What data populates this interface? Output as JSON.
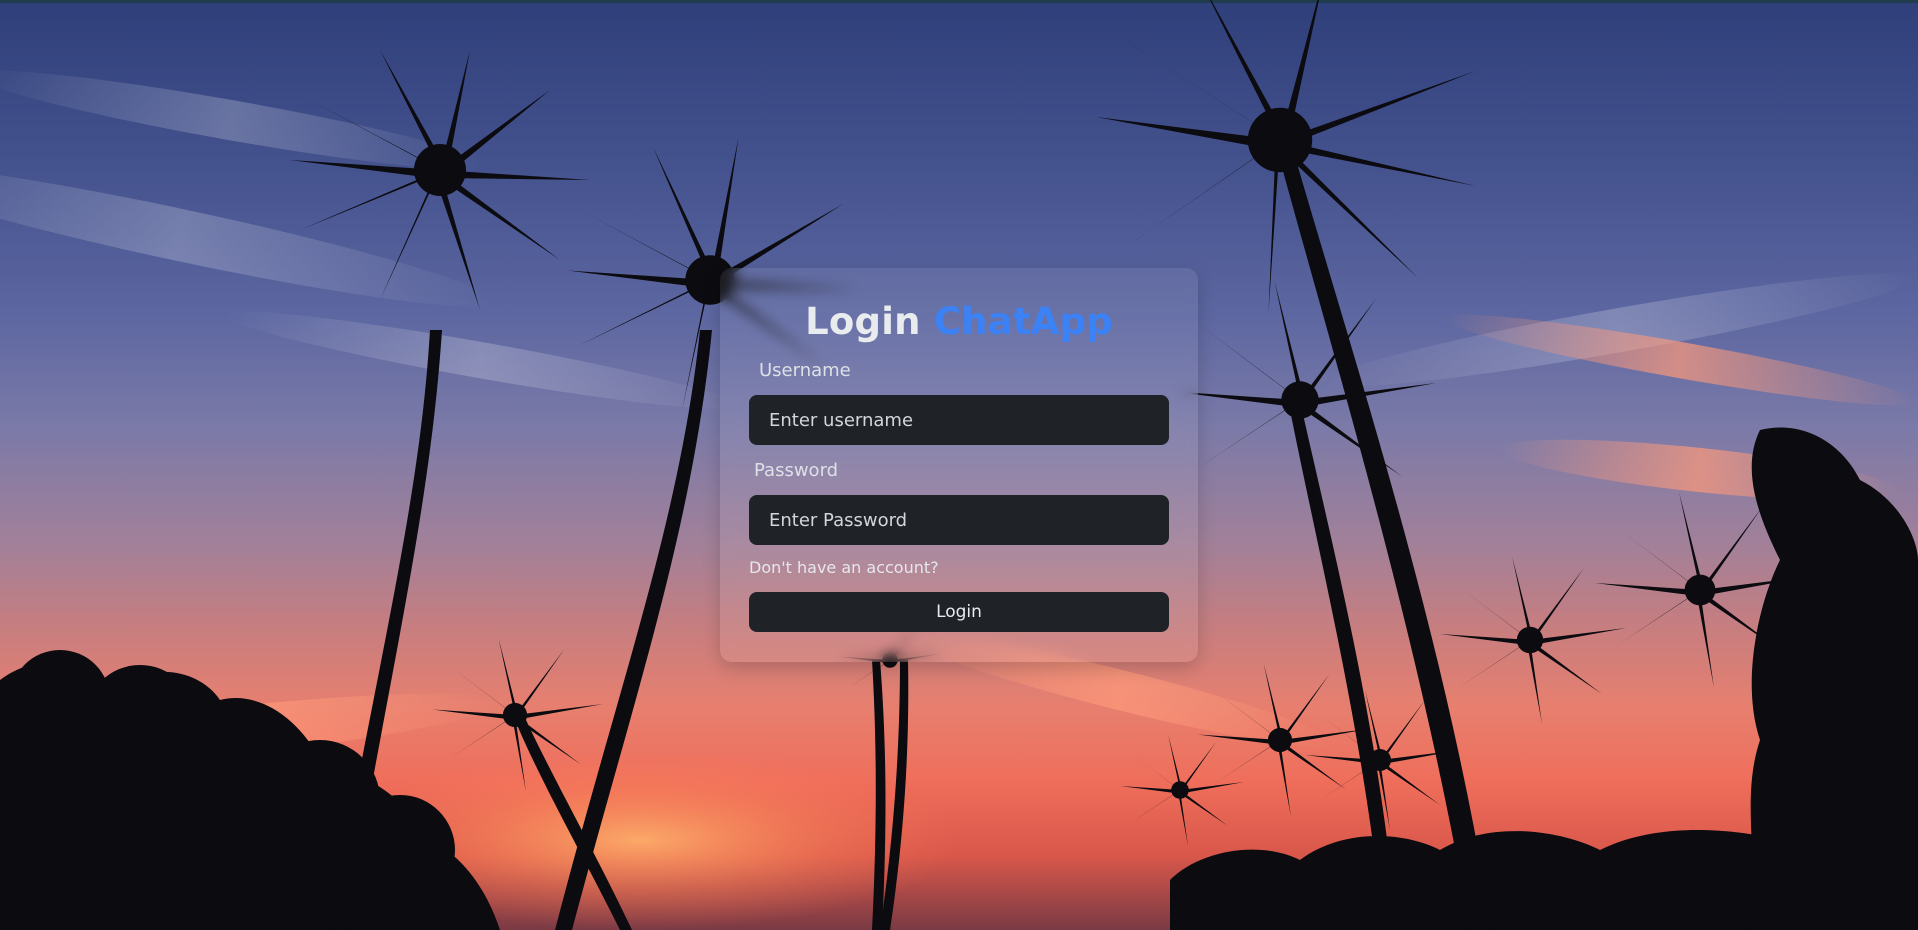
{
  "login": {
    "title_prefix": "Login",
    "title_brand": "ChatApp",
    "username_label": "Username",
    "username_placeholder": "Enter username",
    "username_value": "",
    "password_label": "Password",
    "password_placeholder": "Enter Password",
    "password_value": "",
    "signup_link": "Don't have an account?",
    "submit_label": "Login"
  },
  "colors": {
    "brand_accent": "#3b82f6",
    "input_bg": "#1f2328",
    "button_bg": "#1f2328"
  },
  "background": {
    "scene": "tropical sunset with palm tree silhouettes"
  }
}
